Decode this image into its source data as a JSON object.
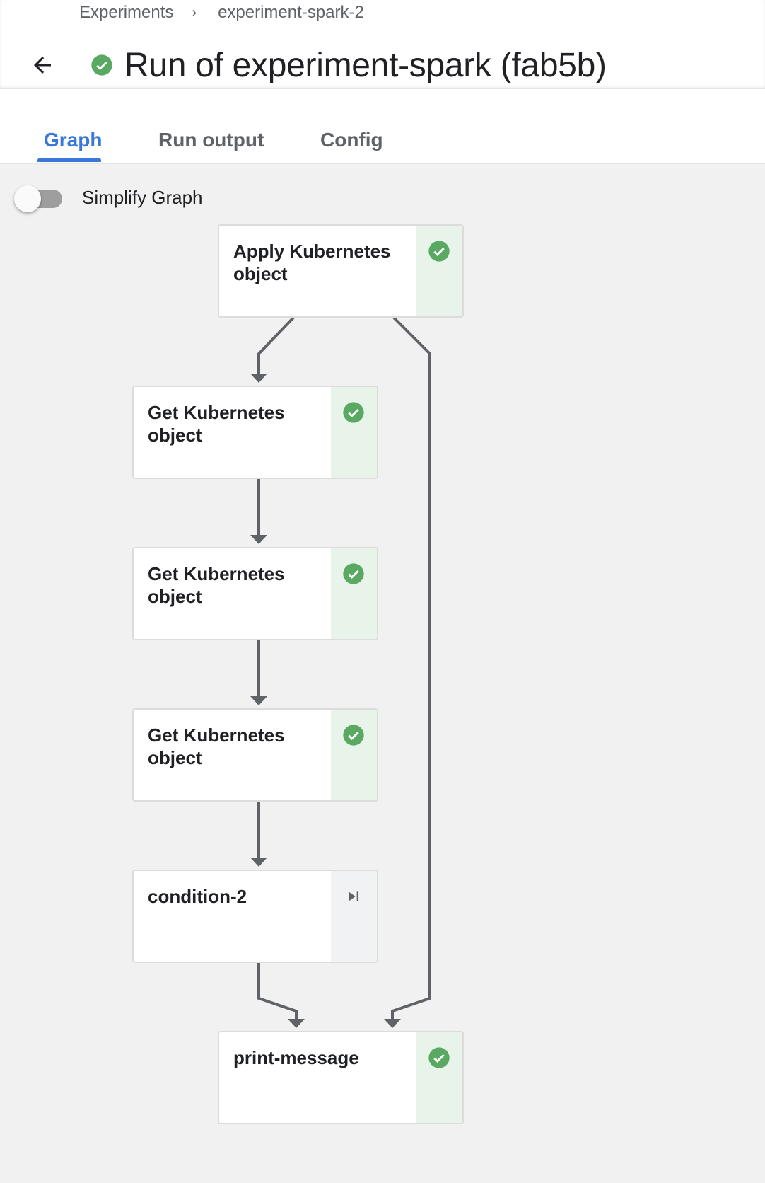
{
  "breadcrumb": {
    "items": [
      "Experiments",
      "experiment-spark-2"
    ],
    "separator": "›"
  },
  "header": {
    "title": "Run of experiment-spark (fab5b)",
    "status": "succeeded",
    "back_icon": "arrow-back-icon"
  },
  "tabs": [
    {
      "label": "Graph",
      "active": true
    },
    {
      "label": "Run output",
      "active": false
    },
    {
      "label": "Config",
      "active": false
    }
  ],
  "simplify_toggle": {
    "label": "Simplify Graph",
    "on": false
  },
  "colors": {
    "accent": "#3a78d8",
    "success": "#5aa962",
    "success_bg": "#e8f4ea",
    "edge": "#5f6368",
    "skipped_bg": "#f1f2f4"
  },
  "graph": {
    "nodes": [
      {
        "id": "apply",
        "label": "Apply Kubernetes object",
        "status": "succeeded"
      },
      {
        "id": "get1",
        "label": "Get Kubernetes object",
        "status": "succeeded"
      },
      {
        "id": "get2",
        "label": "Get Kubernetes object",
        "status": "succeeded"
      },
      {
        "id": "get3",
        "label": "Get Kubernetes object",
        "status": "succeeded"
      },
      {
        "id": "cond",
        "label": "condition-2",
        "status": "skipped"
      },
      {
        "id": "print",
        "label": "print-message",
        "status": "succeeded"
      }
    ],
    "edges": [
      [
        "apply",
        "get1"
      ],
      [
        "get1",
        "get2"
      ],
      [
        "get2",
        "get3"
      ],
      [
        "get3",
        "cond"
      ],
      [
        "cond",
        "print"
      ],
      [
        "apply",
        "print"
      ]
    ]
  }
}
